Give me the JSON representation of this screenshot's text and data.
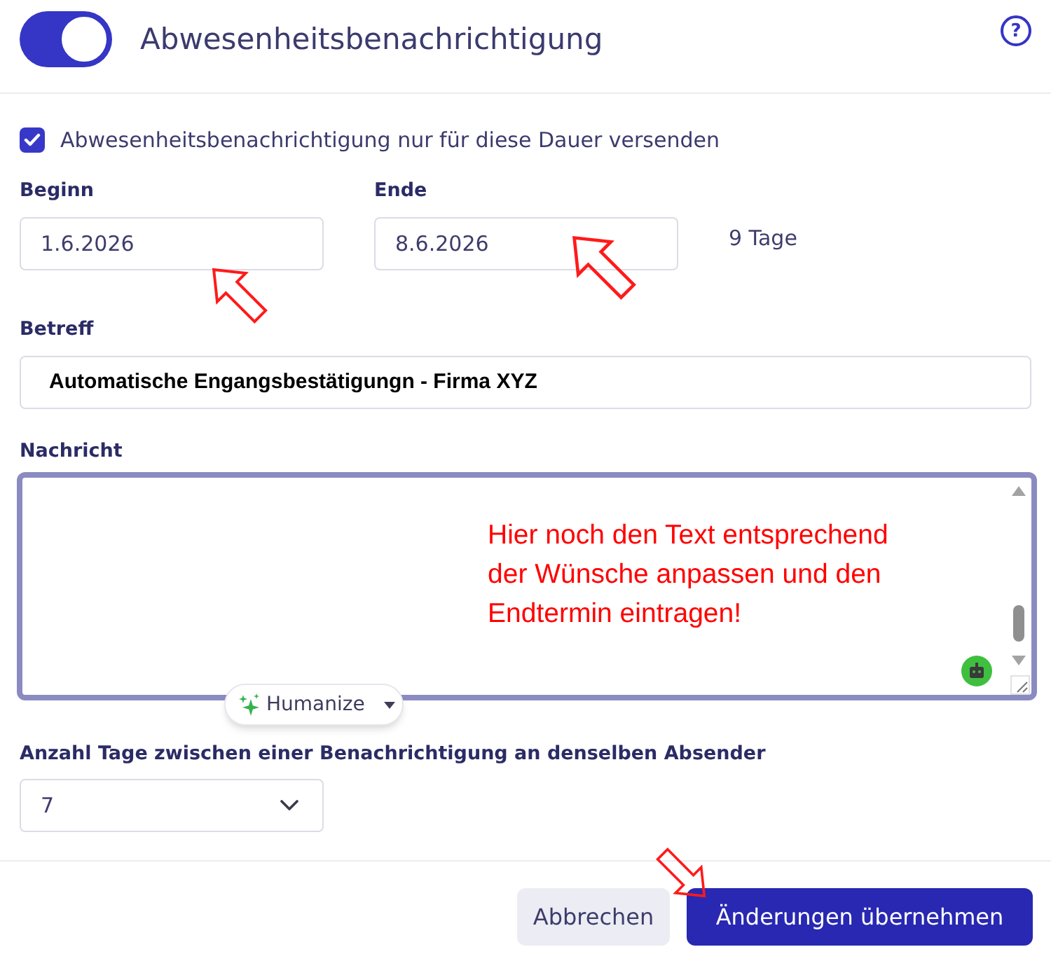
{
  "header": {
    "toggle": {
      "on": true
    },
    "title": "Abwesenheitsbenachrichtigung",
    "help": "?"
  },
  "duration_checkbox": {
    "label": "Abwesenheitsbenachrichtigung nur für diese Dauer versenden",
    "checked": true
  },
  "start_date": {
    "label": "Beginn",
    "value": "1.6.2026"
  },
  "end_date": {
    "label": "Ende",
    "value": "8.6.2026"
  },
  "duration": "9 Tage",
  "subject": {
    "label": "Betreff",
    "value": "Automatische Engangsbestätigungn - Firma XYZ"
  },
  "message": {
    "label": "Nachricht",
    "annotation_lines": [
      "Hier noch den Text entsprechend",
      "der Wünsche anpassen und den",
      "Endtermin eintragen!"
    ],
    "humanize": "Humanize"
  },
  "interval": {
    "label": "Anzahl Tage zwischen einer Benachrichtigung an denselben Absender",
    "value": "7"
  },
  "buttons": [
    {
      "label": "Abbrechen",
      "kind": "secondary"
    },
    {
      "label": "Änderungen übernehmen",
      "kind": "primary"
    }
  ]
}
